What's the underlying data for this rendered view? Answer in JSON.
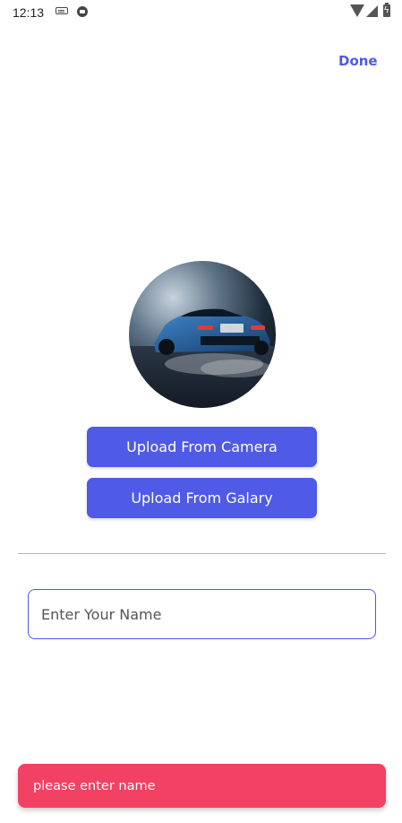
{
  "status_bar": {
    "time": "12:13",
    "icons": [
      "keyboard-icon",
      "media-icon",
      "wifi-icon",
      "signal-icon",
      "battery-charging-icon"
    ]
  },
  "header": {
    "done_label": "Done",
    "accent_color": "#4f5ae6"
  },
  "profile": {
    "avatar_icon": "car-photo"
  },
  "buttons": {
    "camera_label": "Upload From Camera",
    "gallery_label": "Upload From Galary"
  },
  "name_input": {
    "placeholder": "Enter Your Name",
    "value": ""
  },
  "snackbar": {
    "message": "please enter name",
    "color": "#f24162"
  }
}
